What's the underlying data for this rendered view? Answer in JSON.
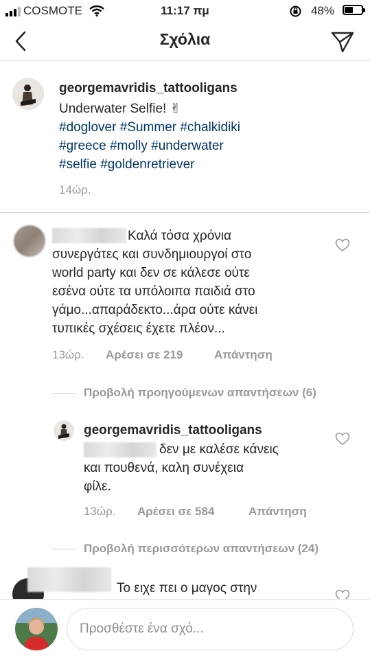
{
  "status_bar": {
    "carrier": "COSMOTE",
    "time": "11:17 πμ",
    "battery": "48%",
    "battery_level": 0.48
  },
  "header": {
    "title": "Σχόλια",
    "back_icon": "chevron-left-icon",
    "send_icon": "paper-plane-icon"
  },
  "caption": {
    "username": "georgemavridis_tattooligans",
    "text": "Underwater Selfie! ✌",
    "hashtags_line1": "#doglover #Summer #chalkidiki",
    "hashtags_line2": "#greece #molly #underwater",
    "hashtags_line3": "#selfie #goldenretriever",
    "time": "14ώρ."
  },
  "comment1": {
    "line1": "Καλά τόσα χρόνια",
    "line2": "συνεργάτες και συνδημιουργοί στο",
    "line3": "world party και δεν σε κάλεσε ούτε",
    "line4": "εσένα ούτε τα υπόλοιπα παιδιά στο",
    "line5": "γάμο...απαράδεκτο...άρα ούτε κάνει",
    "line6": "τυπικές σχέσεις έχετε πλέον...",
    "time": "13ώρ.",
    "likes": "Αρέσει σε 219",
    "reply": "Απάντηση"
  },
  "view_previous_replies": "Προβολή προηγούμενων απαντήσεων (6)",
  "reply1": {
    "username": "georgemavridis_tattooligans",
    "line1": "δεν με καλέσε κάνεις",
    "line2": "και πουθενά, καλη συνέχεια",
    "line3": "φίλε.",
    "time": "13ώρ.",
    "likes": "Αρέσει σε 584",
    "reply": "Απάντηση"
  },
  "view_more_replies": "Προβολή περισσότερων απαντήσεων (24)",
  "comment2": {
    "line1": "Το ειχε πει ο μαγος στην"
  },
  "composer": {
    "placeholder": "Προσθέστε ένα σχό..."
  },
  "colors": {
    "hashtag": "#003569",
    "meta": "#999999",
    "divider": "#dbdbdb"
  }
}
